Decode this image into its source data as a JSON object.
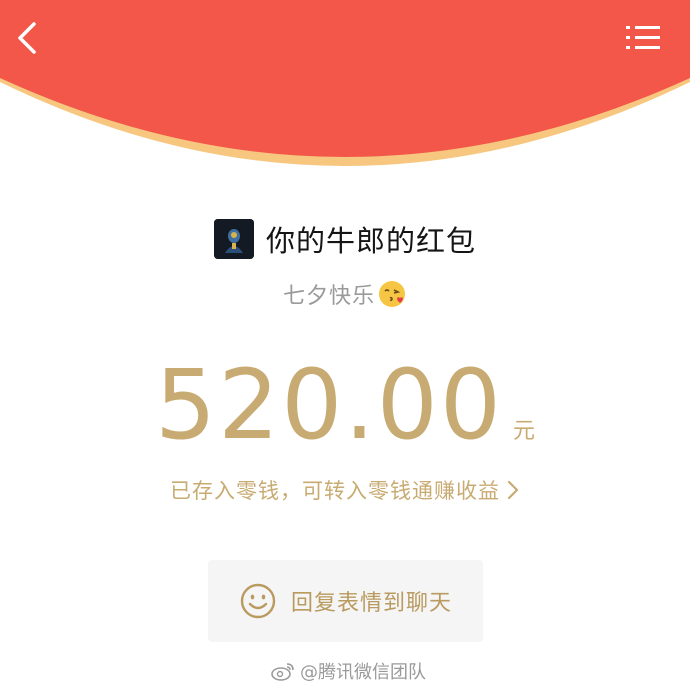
{
  "header": {
    "back_icon": "chevron-left-icon",
    "menu_icon": "list-menu-icon",
    "background_color": "#f2574a",
    "rim_color": "#f7c67f"
  },
  "sender": {
    "avatar_icon": "avatar-image",
    "title": "你的牛郎的红包"
  },
  "greeting": {
    "text": "七夕快乐",
    "emoji_icon": "face-blowing-kiss-emoji"
  },
  "amount": {
    "value": "520.00",
    "unit": "元",
    "color": "#c8ab72"
  },
  "note": {
    "text": "已存入零钱，可转入零钱通赚收益",
    "chevron_icon": "chevron-right-icon"
  },
  "reply_button": {
    "icon": "smiley-face-icon",
    "label": "回复表情到聊天"
  },
  "watermark": {
    "icon": "weibo-icon",
    "text": "@腾讯微信团队"
  }
}
